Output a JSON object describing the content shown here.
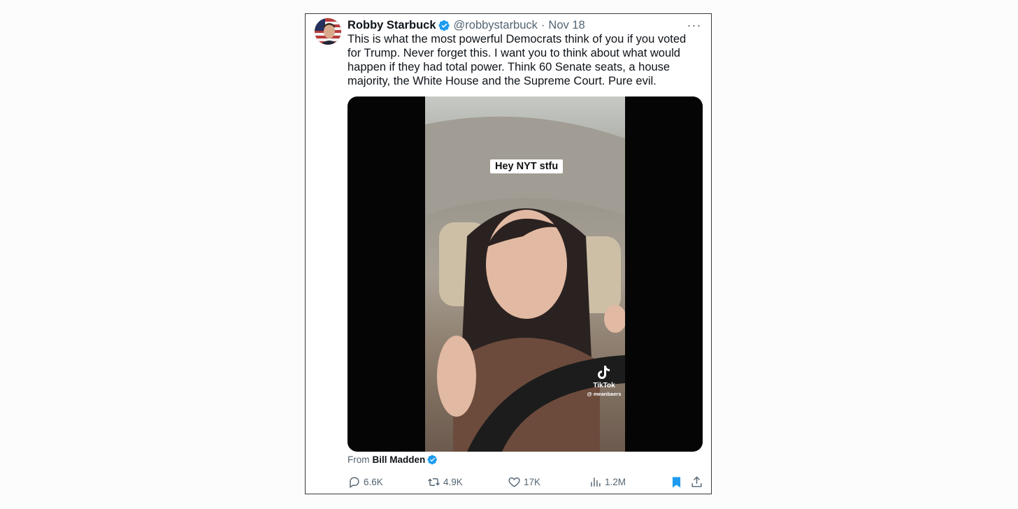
{
  "tweet": {
    "author_name": "Robby Starbuck",
    "handle": "@robbystarbuck",
    "separator": "·",
    "date": "Nov 18",
    "more_label": "···",
    "text": "This is what the most powerful Democrats think of you if you voted for Trump. Never forget this. I want you to think about what would happen if they had total power. Think 60 Senate seats, a house majority, the White House and the Supreme Court. Pure evil."
  },
  "media": {
    "caption": "Hey NYT stfu",
    "watermark_brand": "TikTok",
    "watermark_handle": "@ meanbaers"
  },
  "attribution": {
    "prefix": "From",
    "name": "Bill Madden"
  },
  "actions": {
    "replies": "6.6K",
    "reposts": "4.9K",
    "likes": "17K",
    "views": "1.2M"
  },
  "icons": {
    "verified": "verified-badge-icon",
    "reply": "reply-icon",
    "repost": "repost-icon",
    "like": "heart-icon",
    "views": "analytics-icon",
    "bookmark": "bookmark-icon",
    "share": "share-icon"
  },
  "colors": {
    "verified": "#1d9bf0",
    "bookmark": "#1d9bf0",
    "muted": "#536471",
    "text": "#0f1419"
  }
}
